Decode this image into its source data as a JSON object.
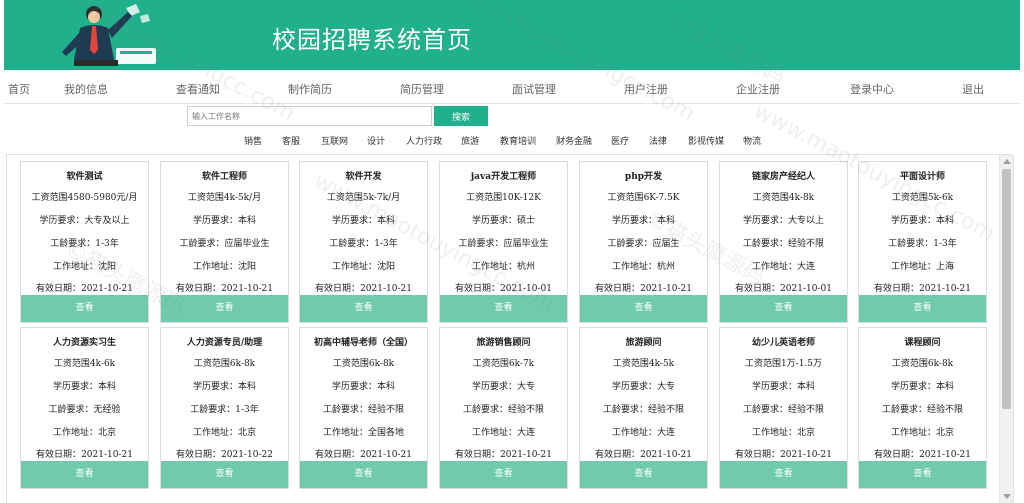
{
  "header": {
    "title": "校园招聘系统首页"
  },
  "nav": [
    "首页",
    "我的信息",
    "查看通知",
    "制作简历",
    "简历管理",
    "面试管理",
    "用户注册",
    "企业注册",
    "登录中心",
    "退出"
  ],
  "search": {
    "placeholder": "输入工作名称",
    "button": "搜索"
  },
  "categories": [
    "销售",
    "客服",
    "互联网",
    "设计",
    "人力行政",
    "旅游",
    "教育培训",
    "财务金融",
    "医疗",
    "法律",
    "影视传媒",
    "物流"
  ],
  "labels": {
    "salary": "工资范围",
    "education": "学历要求：",
    "experience": "工龄要求：",
    "location": "工作地址：",
    "valid_date": "有效日期：",
    "view": "查看"
  },
  "jobs": [
    {
      "title": "软件测试",
      "salary": "4580-5980元/月",
      "education": "大专及以上",
      "experience": "1-3年",
      "location": "沈阳",
      "date": "2021-10-21"
    },
    {
      "title": "软件工程师",
      "salary": "4k-5k/月",
      "education": "本科",
      "experience": "应届毕业生",
      "location": "沈阳",
      "date": "2021-10-21"
    },
    {
      "title": "软件开发",
      "salary": "5k-7k/月",
      "education": "本科",
      "experience": "1-3年",
      "location": "沈阳",
      "date": "2021-10-21"
    },
    {
      "title": "java开发工程师",
      "salary": "10K-12K",
      "education": "硕士",
      "experience": "应届毕业生",
      "location": "杭州",
      "date": "2021-10-01"
    },
    {
      "title": "php开发",
      "salary": "6K-7.5K",
      "education": "本科",
      "experience": "应届生",
      "location": "杭州",
      "date": "2021-10-21"
    },
    {
      "title": "链家房产经纪人",
      "salary": "4k-8k",
      "education": "大专以上",
      "experience": "经验不限",
      "location": "大连",
      "date": "2021-10-01"
    },
    {
      "title": "平面设计师",
      "salary": "5k-6k",
      "education": "本科",
      "experience": "1-3年",
      "location": "上海",
      "date": "2021-10-21"
    },
    {
      "title": "人力资源实习生",
      "salary": "4k-6k",
      "education": "本科",
      "experience": "无经验",
      "location": "北京",
      "date": "2021-10-21"
    },
    {
      "title": "人力资源专员/助理",
      "salary": "6k-8k",
      "education": "本科",
      "experience": "1-3年",
      "location": "北京",
      "date": "2021-10-22"
    },
    {
      "title": "初高中辅导老师（全国）",
      "salary": "6k-8k",
      "education": "本科",
      "experience": "经验不限",
      "location": "全国各地",
      "date": "2021-10-21"
    },
    {
      "title": "旅游销售顾问",
      "salary": "6k-7k",
      "education": "大专",
      "experience": "经验不限",
      "location": "大连",
      "date": "2021-10-21"
    },
    {
      "title": "旅游顾问",
      "salary": "4k-5k",
      "education": "大专",
      "experience": "经验不限",
      "location": "大连",
      "date": "2021-10-21"
    },
    {
      "title": "幼少儿英语老师",
      "salary": "1万-1.5万",
      "education": "本科",
      "experience": "经验不限",
      "location": "北京",
      "date": "2021-10-21"
    },
    {
      "title": "课程顾问",
      "salary": "6k-8k",
      "education": "本科",
      "experience": "经验不限",
      "location": "北京",
      "date": "2021-10-21"
    }
  ],
  "watermark": {
    "text": "©猫头鹰源码",
    "url": "www.maotouyingcc.com"
  },
  "colors": {
    "brand": "#21b08c",
    "button": "#6fcba9"
  }
}
